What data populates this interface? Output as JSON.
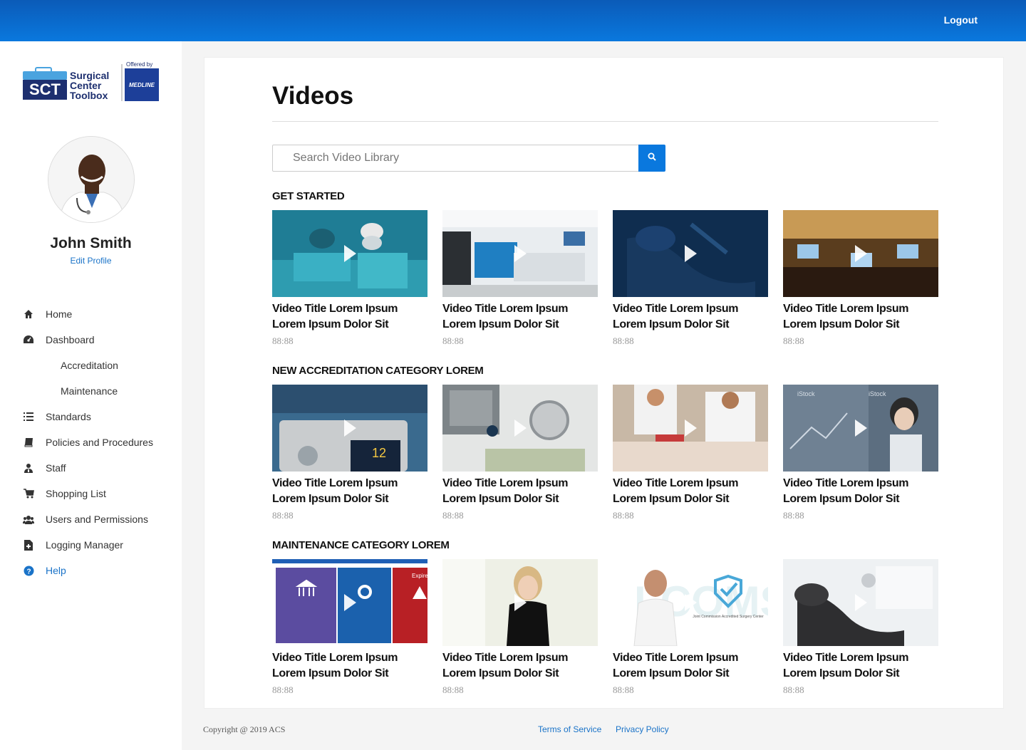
{
  "header": {
    "logout_label": "Logout"
  },
  "brand": {
    "logo_lines": [
      "Surgical",
      "Center",
      "Toolbox"
    ],
    "logo_abbrev": "SCT",
    "offered_by": "Offered by",
    "partner": "MEDLINE"
  },
  "profile": {
    "name": "John Smith",
    "edit_label": "Edit Profile"
  },
  "nav": {
    "home": "Home",
    "dashboard": "Dashboard",
    "accreditation": "Accreditation",
    "maintenance": "Maintenance",
    "standards": "Standards",
    "policies": "Policies and Procedures",
    "staff": "Staff",
    "shopping": "Shopping List",
    "users": "Users and Permissions",
    "logging": "Logging Manager",
    "help": "Help"
  },
  "main": {
    "title": "Videos",
    "search_placeholder": "Search Video Library"
  },
  "sections": [
    {
      "title": "GET STARTED",
      "videos": [
        {
          "title": "Video Title Lorem Ipsum Lorem Ipsum Dolor Sit",
          "duration": "88:88",
          "thumb": "surgeons"
        },
        {
          "title": "Video Title Lorem Ipsum Lorem Ipsum Dolor Sit",
          "duration": "88:88",
          "thumb": "reception"
        },
        {
          "title": "Video Title Lorem Ipsum Lorem Ipsum Dolor Sit",
          "duration": "88:88",
          "thumb": "dental-chair-dark"
        },
        {
          "title": "Video Title Lorem Ipsum Lorem Ipsum Dolor Sit",
          "duration": "88:88",
          "thumb": "conference"
        }
      ]
    },
    {
      "title": "NEW ACCREDITATION CATEGORY LOREM",
      "videos": [
        {
          "title": "Video Title Lorem Ipsum Lorem Ipsum Dolor Sit",
          "duration": "88:88",
          "thumb": "monitor"
        },
        {
          "title": "Video Title Lorem Ipsum Lorem Ipsum Dolor Sit",
          "duration": "88:88",
          "thumb": "stethoscope"
        },
        {
          "title": "Video Title Lorem Ipsum Lorem Ipsum Dolor Sit",
          "duration": "88:88",
          "thumb": "emergency"
        },
        {
          "title": "Video Title Lorem Ipsum Lorem Ipsum Dolor Sit",
          "duration": "88:88",
          "thumb": "lab"
        }
      ]
    },
    {
      "title": "MAINTENANCE CATEGORY LOREM",
      "videos": [
        {
          "title": "Video Title Lorem Ipsum Lorem Ipsum Dolor Sit",
          "duration": "88:88",
          "thumb": "app-screens"
        },
        {
          "title": "Video Title Lorem Ipsum Lorem Ipsum Dolor Sit",
          "duration": "88:88",
          "thumb": "woman"
        },
        {
          "title": "Video Title Lorem Ipsum Lorem Ipsum Dolor Sit",
          "duration": "88:88",
          "thumb": "joint-commission"
        },
        {
          "title": "Video Title Lorem Ipsum Lorem Ipsum Dolor Sit",
          "duration": "88:88",
          "thumb": "dental-chair"
        }
      ]
    }
  ],
  "thumb_texts": {
    "expired": "Expired",
    "joint_commission": "Joint Commission Accredited Surgery Center",
    "istock": "iStock"
  },
  "footer": {
    "copyright": "Copyright @ 2019 ACS",
    "terms": "Terms of Service",
    "privacy": "Privacy Policy"
  },
  "colors": {
    "accent": "#0a78de",
    "link": "#1a73c8",
    "header_dark": "#0b5bb8"
  }
}
